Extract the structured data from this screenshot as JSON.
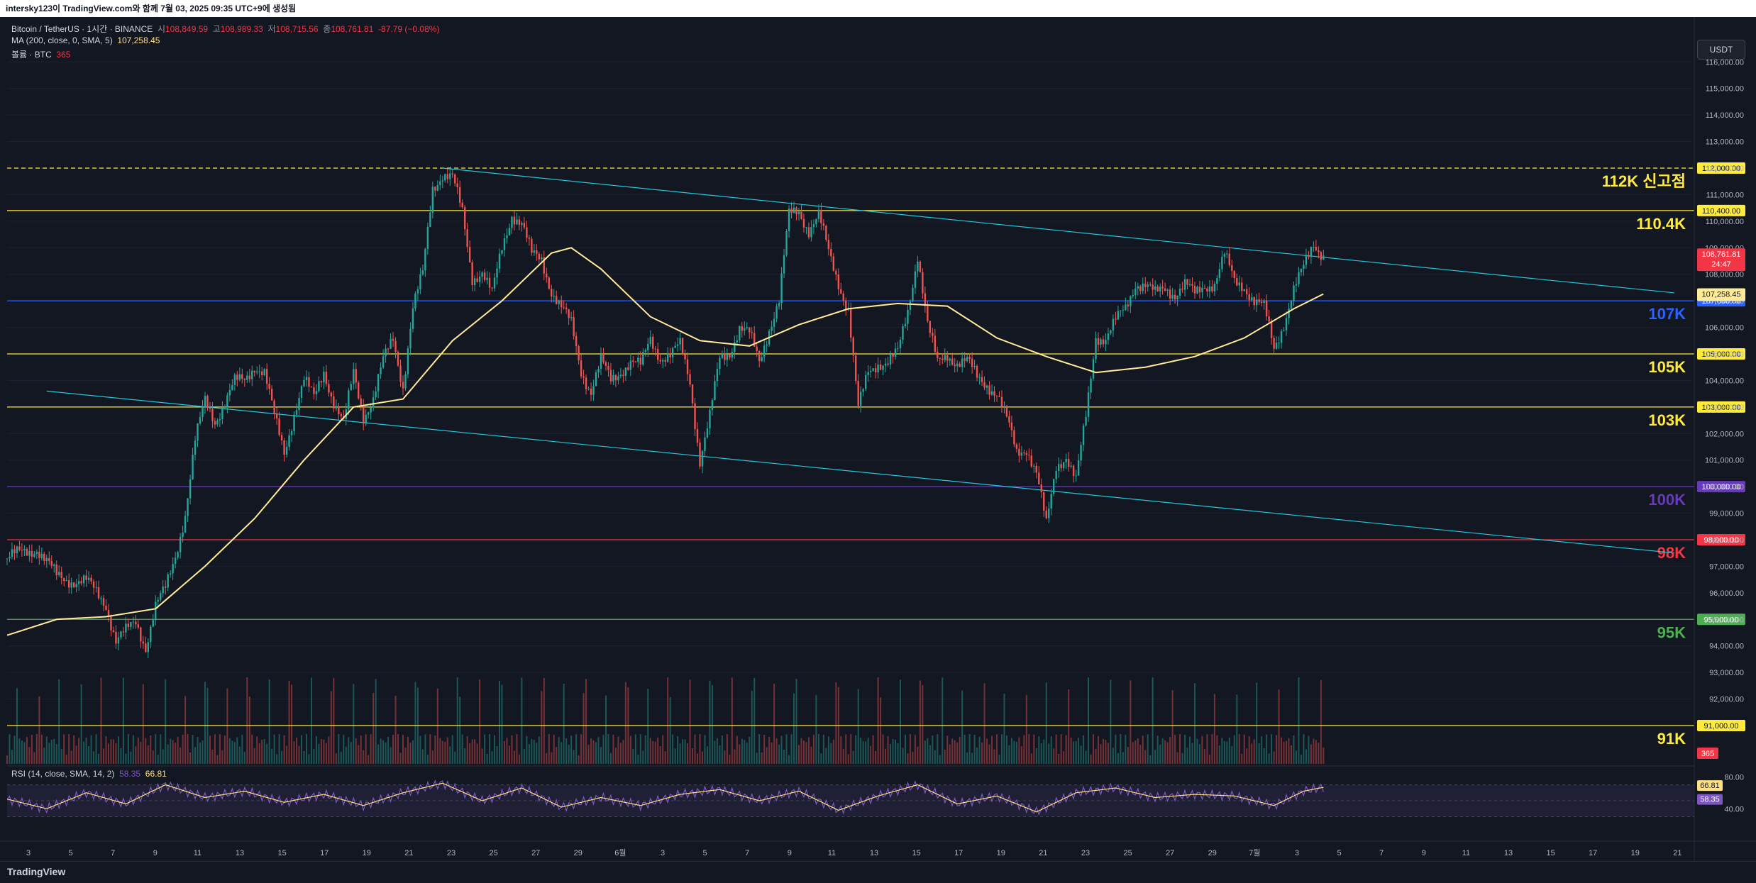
{
  "header": {
    "title": "intersky123이 TradingView.com와 함께 7월 03, 2025 09:35 UTC+9에 생성됨"
  },
  "legend": {
    "symbol": "Bitcoin / TetherUS · 1시간 · BINANCE",
    "open_label": "시",
    "open": "108,849.59",
    "high_label": "고",
    "high": "108,989.33",
    "low_label": "저",
    "low": "108,715.56",
    "close_label": "종",
    "close": "108,761.81",
    "change": "-87.79 (−0.08%)",
    "ma_label": "MA (200, close, 0, SMA, 5)",
    "ma_value": "107,258.45",
    "volume_label": "볼륨 · BTC",
    "volume_value": "365",
    "rsi_label": "RSI (14, close, SMA, 14, 2)",
    "rsi_value1": "58.35",
    "rsi_value2": "66.81"
  },
  "currency_button": "USDT",
  "footer": {
    "logo": "TradingView"
  },
  "colors": {
    "background": "#131722",
    "up": "#26a69a",
    "down": "#ef5350",
    "ma": "#ffeb99",
    "trendline": "#26c6da",
    "rsi": "#7e57c2",
    "rsi_ma": "#ffe083"
  },
  "chart_data": {
    "type": "candlestick",
    "title": "Bitcoin / TetherUS · 1시간 · BINANCE",
    "y_ticks": [
      92000,
      93000,
      94000,
      95000,
      96000,
      97000,
      98000,
      99000,
      100000,
      101000,
      102000,
      103000,
      104000,
      105000,
      106000,
      107000,
      108000,
      109000,
      110000,
      111000,
      112000,
      113000,
      114000,
      115000,
      116000
    ],
    "y_tick_labels": [
      "92,000.00",
      "93,000.00",
      "94,000.00",
      "95,000.00",
      "96,000.00",
      "97,000.00",
      "98,000.00",
      "99,000.00",
      "100,000.00",
      "101,000.00",
      "102,000.00",
      "103,000.00",
      "104,000.00",
      "105,000.00",
      "106,000.00",
      "107,000.00",
      "108,000.00",
      "109,000.00",
      "110,000.00",
      "111,000.00",
      "112,000.00",
      "113,000.00",
      "114,000.00",
      "115,000.00",
      "116,000.00"
    ],
    "x_tick_labels": [
      "3",
      "5",
      "7",
      "9",
      "11",
      "13",
      "15",
      "17",
      "19",
      "21",
      "23",
      "25",
      "27",
      "29",
      "6월",
      "3",
      "5",
      "7",
      "9",
      "11",
      "13",
      "15",
      "17",
      "19",
      "21",
      "23",
      "25",
      "27",
      "29",
      "7월",
      "3",
      "5",
      "7",
      "9",
      "11",
      "13",
      "15",
      "17",
      "19",
      "21"
    ],
    "price_series": [
      [
        0,
        97300
      ],
      [
        3,
        97700
      ],
      [
        5,
        96600
      ],
      [
        8,
        96400
      ],
      [
        10,
        95600
      ],
      [
        11,
        94200
      ],
      [
        12,
        94500
      ],
      [
        13,
        94900
      ],
      [
        14,
        94000
      ],
      [
        15,
        95500
      ],
      [
        16,
        96100
      ],
      [
        17,
        97400
      ],
      [
        18,
        99000
      ],
      [
        19,
        101700
      ],
      [
        20,
        103200
      ],
      [
        21,
        102500
      ],
      [
        22,
        103200
      ],
      [
        23,
        103900
      ],
      [
        24,
        104000
      ],
      [
        25,
        104600
      ],
      [
        26,
        104300
      ],
      [
        27,
        102600
      ],
      [
        28,
        101300
      ],
      [
        29,
        102800
      ],
      [
        30,
        104000
      ],
      [
        31,
        103300
      ],
      [
        32,
        104400
      ],
      [
        33,
        103200
      ],
      [
        34,
        102300
      ],
      [
        35,
        104300
      ],
      [
        36,
        102700
      ],
      [
        37,
        103300
      ],
      [
        38,
        104700
      ],
      [
        39,
        105600
      ],
      [
        40,
        103800
      ],
      [
        41,
        106700
      ],
      [
        42,
        108000
      ],
      [
        43,
        111300
      ],
      [
        44,
        111800
      ],
      [
        45,
        111600
      ],
      [
        46,
        110300
      ],
      [
        47,
        107900
      ],
      [
        48,
        108100
      ],
      [
        49,
        107200
      ],
      [
        50,
        109000
      ],
      [
        51,
        110300
      ],
      [
        52,
        109900
      ],
      [
        53,
        108700
      ],
      [
        54,
        108600
      ],
      [
        55,
        107400
      ],
      [
        56,
        106700
      ],
      [
        57,
        106100
      ],
      [
        58,
        104400
      ],
      [
        59,
        103600
      ],
      [
        60,
        104700
      ],
      [
        61,
        104000
      ],
      [
        62,
        104400
      ],
      [
        63,
        104700
      ],
      [
        64,
        104500
      ],
      [
        65,
        105600
      ],
      [
        66,
        104900
      ],
      [
        67,
        104900
      ],
      [
        68,
        105300
      ],
      [
        69,
        104000
      ],
      [
        70,
        101000
      ],
      [
        71,
        102600
      ],
      [
        72,
        104800
      ],
      [
        73,
        105100
      ],
      [
        74,
        106000
      ],
      [
        75,
        105700
      ],
      [
        76,
        104700
      ],
      [
        77,
        106000
      ],
      [
        78,
        107000
      ],
      [
        79,
        110200
      ],
      [
        80,
        110400
      ],
      [
        81,
        109700
      ],
      [
        82,
        110200
      ],
      [
        83,
        108800
      ],
      [
        84,
        107700
      ],
      [
        85,
        106700
      ],
      [
        86,
        102900
      ],
      [
        87,
        104300
      ],
      [
        88,
        104700
      ],
      [
        89,
        104700
      ],
      [
        90,
        105000
      ],
      [
        91,
        106600
      ],
      [
        92,
        108800
      ],
      [
        93,
        106100
      ],
      [
        94,
        104600
      ],
      [
        95,
        105000
      ],
      [
        96,
        104700
      ],
      [
        97,
        104700
      ],
      [
        98,
        104100
      ],
      [
        99,
        103900
      ],
      [
        100,
        103500
      ],
      [
        101,
        102500
      ],
      [
        102,
        101300
      ],
      [
        103,
        101500
      ],
      [
        104,
        100500
      ],
      [
        105,
        98500
      ],
      [
        106,
        100800
      ],
      [
        107,
        101200
      ],
      [
        108,
        100200
      ],
      [
        109,
        102600
      ],
      [
        110,
        105700
      ],
      [
        111,
        105600
      ],
      [
        112,
        106200
      ],
      [
        113,
        106700
      ],
      [
        114,
        107700
      ],
      [
        115,
        107600
      ],
      [
        116,
        107200
      ],
      [
        117,
        107500
      ],
      [
        118,
        107300
      ],
      [
        119,
        107600
      ],
      [
        120,
        107200
      ],
      [
        121,
        107600
      ],
      [
        122,
        107700
      ],
      [
        123,
        108700
      ],
      [
        124,
        107700
      ],
      [
        125,
        107600
      ],
      [
        126,
        107000
      ],
      [
        127,
        106700
      ],
      [
        128,
        105200
      ],
      [
        129,
        106200
      ],
      [
        130,
        107400
      ],
      [
        131,
        108200
      ],
      [
        132,
        109200
      ],
      [
        133,
        108762
      ]
    ],
    "ma200": [
      [
        0,
        94400
      ],
      [
        5,
        95000
      ],
      [
        10,
        95100
      ],
      [
        15,
        95400
      ],
      [
        20,
        97000
      ],
      [
        25,
        98800
      ],
      [
        30,
        101000
      ],
      [
        35,
        103000
      ],
      [
        40,
        103300
      ],
      [
        45,
        105500
      ],
      [
        50,
        107000
      ],
      [
        55,
        108800
      ],
      [
        57,
        109000
      ],
      [
        60,
        108200
      ],
      [
        65,
        106400
      ],
      [
        70,
        105500
      ],
      [
        75,
        105300
      ],
      [
        80,
        106100
      ],
      [
        85,
        106700
      ],
      [
        90,
        106900
      ],
      [
        95,
        106800
      ],
      [
        100,
        105600
      ],
      [
        105,
        104900
      ],
      [
        110,
        104300
      ],
      [
        115,
        104500
      ],
      [
        120,
        104900
      ],
      [
        125,
        105600
      ],
      [
        130,
        106700
      ],
      [
        133,
        107258
      ]
    ],
    "trendlines": [
      {
        "from": [
          44,
          112000
        ],
        "to": [
          170,
          107300
        ]
      },
      {
        "from": [
          4,
          103600
        ],
        "to": [
          170,
          97500
        ]
      }
    ],
    "levels": [
      {
        "value": 112000,
        "label": "112K 신고점",
        "axis_label": "112,000.00",
        "color": "#ffeb3b",
        "dashed": true
      },
      {
        "value": 110400,
        "label": "110.4K",
        "axis_label": "110,400.00",
        "color": "#ffeb3b",
        "dashed": false
      },
      {
        "value": 107000,
        "label": "107K",
        "axis_label": "107,000.00",
        "color": "#2962ff",
        "dashed": false
      },
      {
        "value": 105000,
        "label": "105K",
        "axis_label": "105,000.00",
        "color": "#ffeb3b",
        "dashed": false
      },
      {
        "value": 103000,
        "label": "103K",
        "axis_label": "103,000.00",
        "color": "#ffeb3b",
        "dashed": false
      },
      {
        "value": 100000,
        "label": "100K",
        "axis_label": "100,000.00",
        "color": "#673ab7",
        "dashed": false
      },
      {
        "value": 98000,
        "label": "98K",
        "axis_label": "98,000.00",
        "color": "#f23645",
        "dashed": false
      },
      {
        "value": 95000,
        "label": "95K",
        "axis_label": "95,000.00",
        "color": "#4caf50",
        "dashed": false
      },
      {
        "value": 91000,
        "label": "91K",
        "axis_label": "91,000.00",
        "color": "#ffeb3b",
        "dashed": false
      }
    ],
    "price_tags": [
      {
        "value": 108761.81,
        "lines": [
          "108,761.81",
          "24:47"
        ],
        "color": "#f23645"
      },
      {
        "value": 107258.45,
        "lines": [
          "107,258.45"
        ],
        "color": "#ffeb99"
      }
    ],
    "rsi": {
      "ticks": [
        "80.00",
        "40.00"
      ],
      "tag_values": [
        "66.81",
        "58.35"
      ],
      "series": [
        [
          0,
          52
        ],
        [
          4,
          40
        ],
        [
          8,
          60
        ],
        [
          12,
          46
        ],
        [
          16,
          70
        ],
        [
          20,
          54
        ],
        [
          24,
          62
        ],
        [
          28,
          48
        ],
        [
          32,
          58
        ],
        [
          36,
          44
        ],
        [
          40,
          60
        ],
        [
          44,
          72
        ],
        [
          48,
          50
        ],
        [
          52,
          66
        ],
        [
          56,
          42
        ],
        [
          60,
          54
        ],
        [
          64,
          44
        ],
        [
          68,
          58
        ],
        [
          72,
          64
        ],
        [
          76,
          50
        ],
        [
          80,
          62
        ],
        [
          84,
          38
        ],
        [
          88,
          56
        ],
        [
          92,
          70
        ],
        [
          96,
          46
        ],
        [
          100,
          56
        ],
        [
          104,
          36
        ],
        [
          108,
          60
        ],
        [
          112,
          66
        ],
        [
          116,
          54
        ],
        [
          120,
          58
        ],
        [
          124,
          56
        ],
        [
          128,
          44
        ],
        [
          131,
          62
        ],
        [
          133,
          66.81
        ]
      ]
    }
  }
}
